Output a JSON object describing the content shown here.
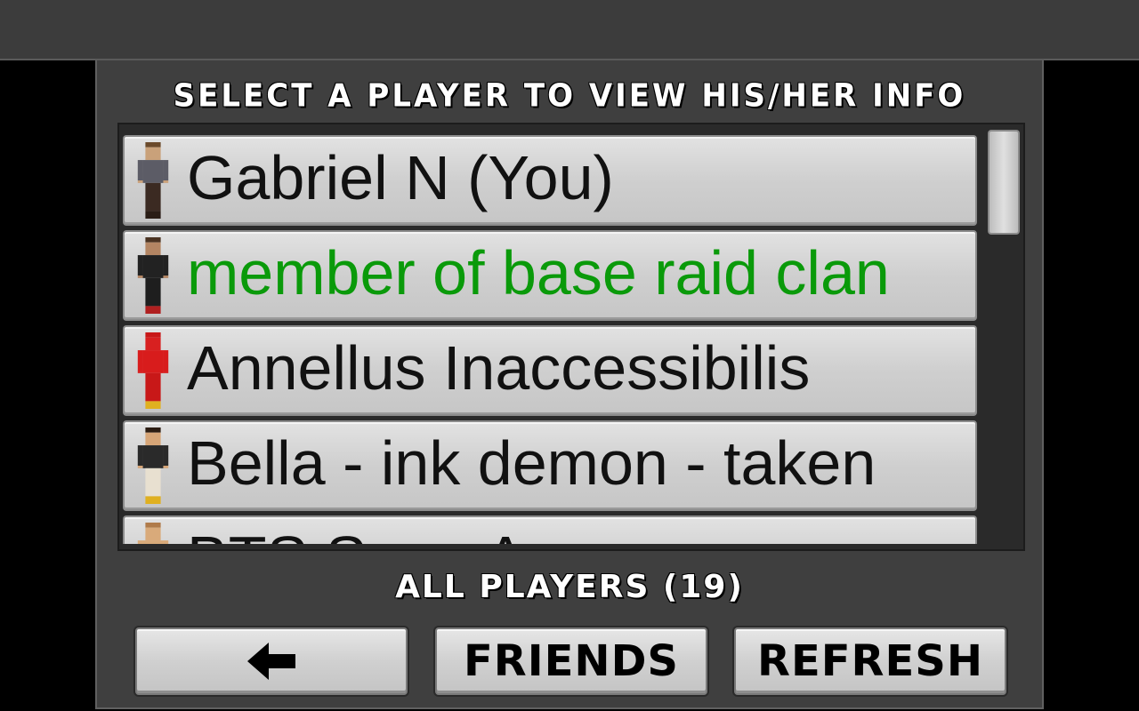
{
  "header": {
    "title": "SELECT A PLAYER TO VIEW HIS/HER INFO"
  },
  "players": [
    {
      "name": "Gabriel N (You)",
      "color": "#111111",
      "skin": {
        "hair": "#6b4a2b",
        "face": "#c9a17a",
        "shirt": "#5c5c66",
        "pants": "#3b2a22",
        "shoes": "#2a1d16"
      }
    },
    {
      "name": "member of base raid clan",
      "color": "#0a9a0a",
      "skin": {
        "hair": "#4a3322",
        "face": "#b38563",
        "shirt": "#222222",
        "pants": "#1e1e1e",
        "shoes": "#b02020"
      }
    },
    {
      "name": "Annellus Inaccessibilis",
      "color": "#111111",
      "skin": {
        "hair": "#c81818",
        "face": "#d82020",
        "shirt": "#d81c1c",
        "pants": "#c81818",
        "shoes": "#e0b020"
      }
    },
    {
      "name": "Bella - ink demon - taken",
      "color": "#111111",
      "skin": {
        "hair": "#2b1c12",
        "face": "#d6a577",
        "shirt": "#2a2a2a",
        "pants": "#e8e0d0",
        "shoes": "#e0b020"
      }
    },
    {
      "name": "BTS Sega Amy",
      "color": "#111111",
      "skin": {
        "hair": "#b07b4a",
        "face": "#d9aa7a",
        "shirt": "#d9aa7a",
        "pants": "#888888",
        "shoes": "#444444"
      }
    }
  ],
  "footer": {
    "count_label": "ALL PLAYERS (19)"
  },
  "buttons": {
    "back_icon": "left-arrow-icon",
    "friends_label": "FRIENDS",
    "refresh_label": "REFRESH"
  }
}
